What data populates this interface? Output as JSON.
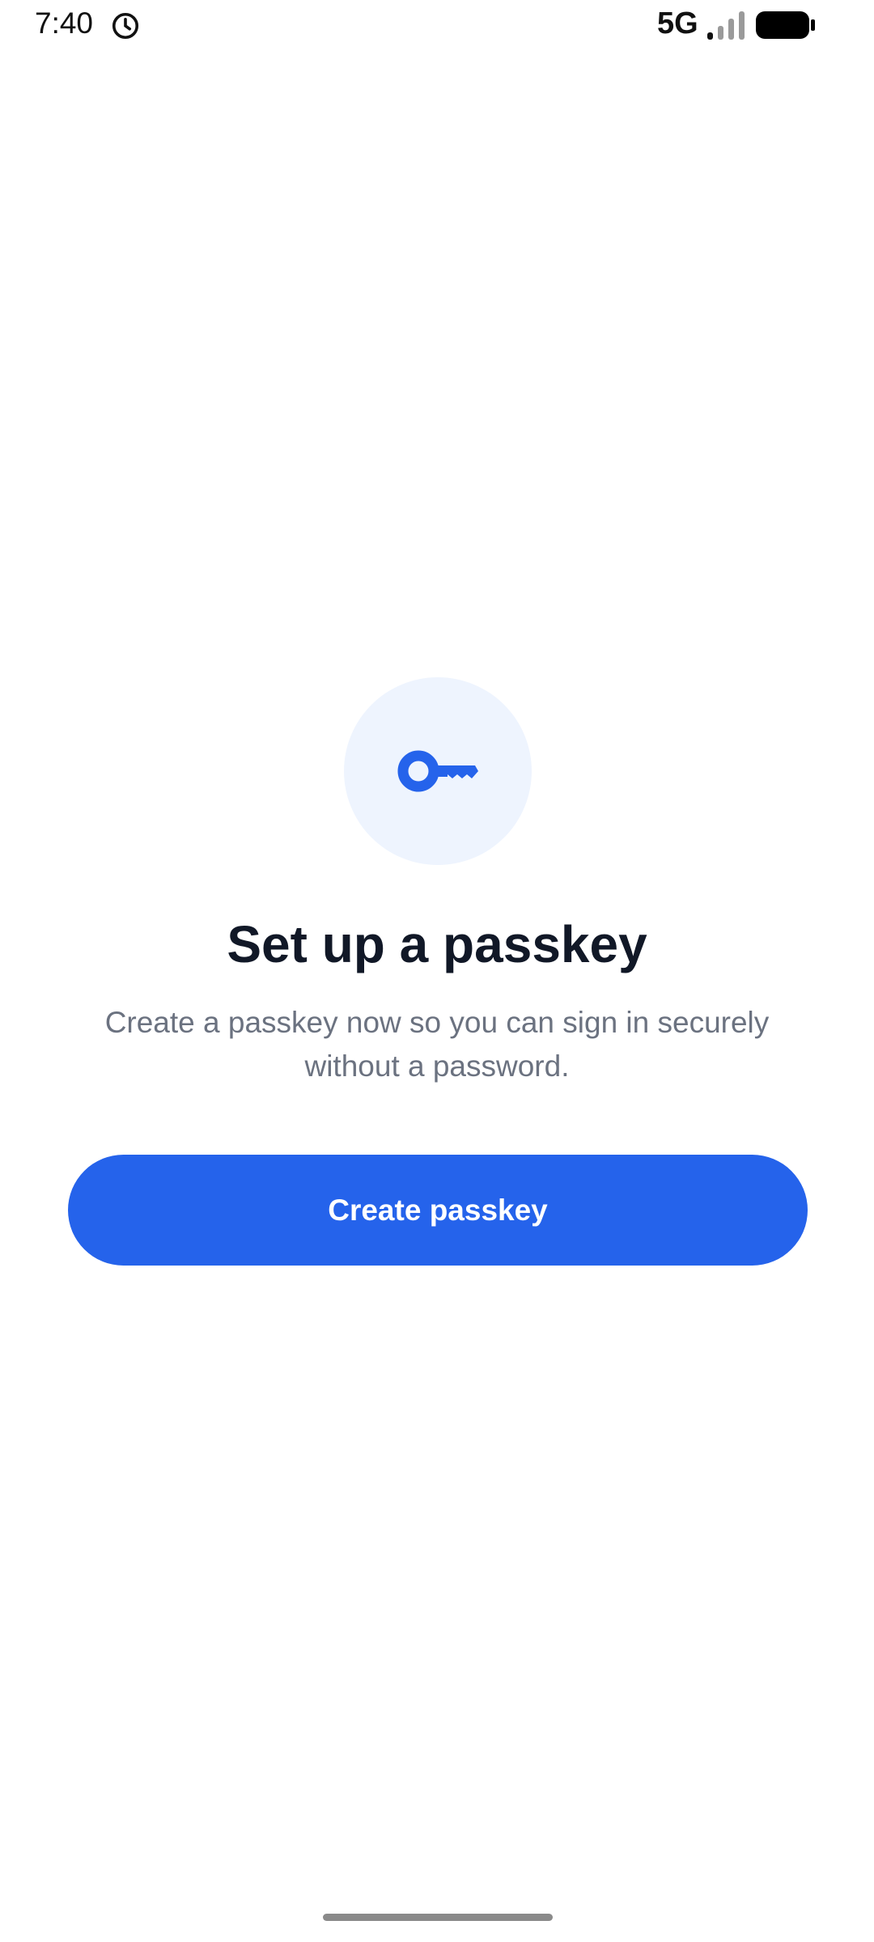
{
  "status_bar": {
    "time": "7:40",
    "network": "5G",
    "icons": [
      "alarm-icon",
      "signal-icon",
      "battery-icon"
    ]
  },
  "main": {
    "icon": "key-icon",
    "title": "Set up a passkey",
    "subtitle": "Create a passkey now so you can sign in securely without a password.",
    "create_button_label": "Create passkey"
  },
  "colors": {
    "accent": "#2563eb",
    "icon_background": "#eef4fe",
    "title": "#111827",
    "subtitle": "#6b7280"
  }
}
